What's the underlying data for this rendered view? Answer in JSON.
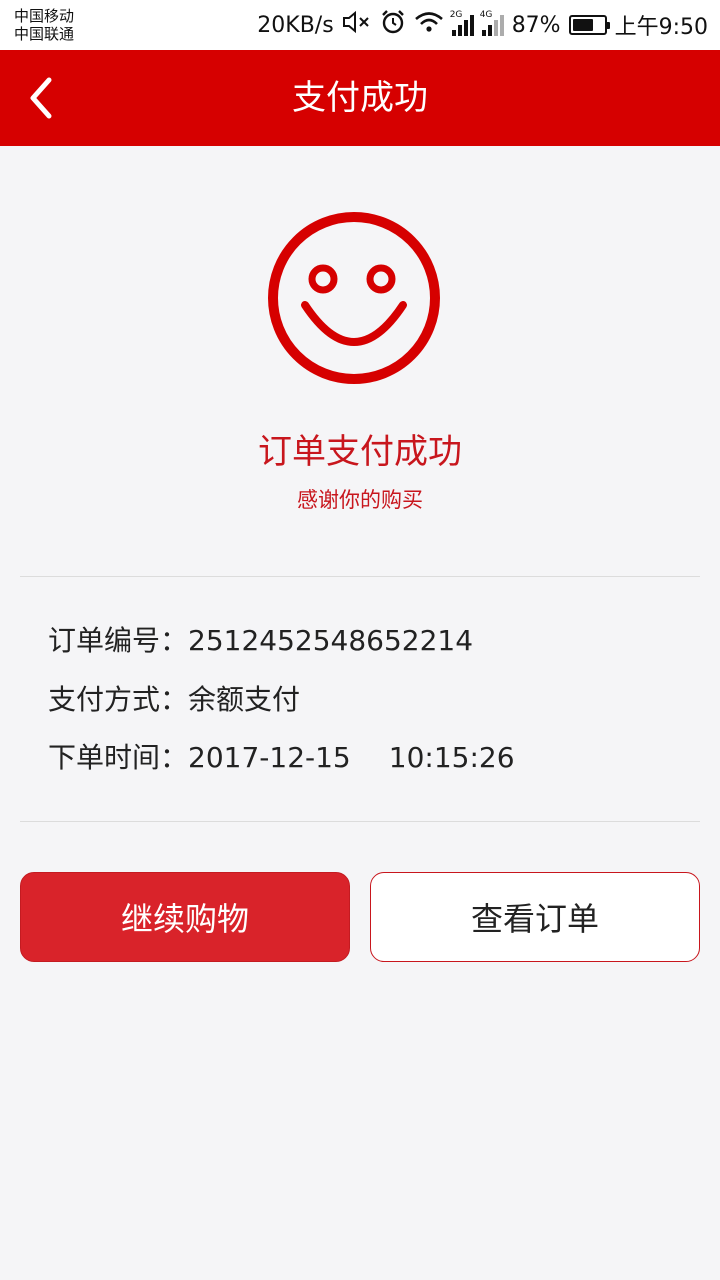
{
  "status_bar": {
    "carrier_1": "中国移动",
    "carrier_2": "中国联通",
    "net_speed": "20KB/s",
    "sim1_gen": "2G",
    "sim2_gen": "4G",
    "battery": "87%",
    "time": "上午9:50",
    "icons": [
      "mute-icon",
      "alarm-icon",
      "wifi-icon",
      "signal-icon",
      "battery-icon"
    ]
  },
  "navbar": {
    "title": "支付成功",
    "back_icon": "back-chevron-icon",
    "background": "#d60000"
  },
  "result": {
    "icon": "smiley-icon",
    "title": "订单支付成功",
    "subtitle": "感谢你的购买",
    "accent_color": "#c8161d"
  },
  "order": {
    "number_label": "订单编号：",
    "number_value": "2512452548652214",
    "payment_label": "支付方式：",
    "payment_value": "余额支付",
    "time_label": "下单时间：",
    "date_value": "2017-12-15",
    "time_value": "10:15:26"
  },
  "actions": {
    "continue_label": "继续购物",
    "view_order_label": "查看订单"
  }
}
